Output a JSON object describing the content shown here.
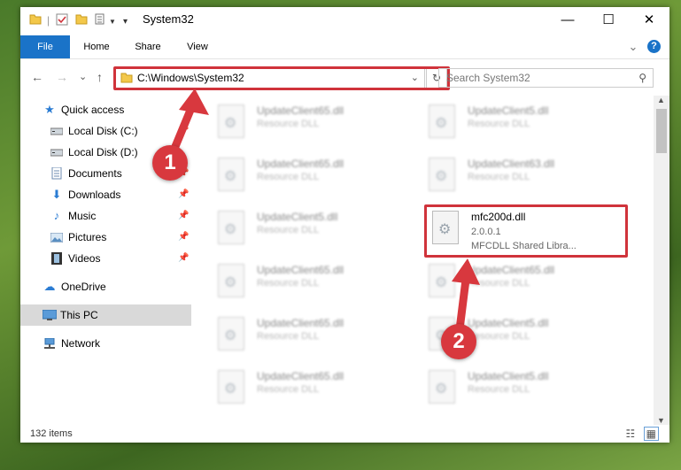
{
  "window": {
    "title": "System32",
    "controls": {
      "minimize": "—",
      "maximize": "☐",
      "close": "✕"
    }
  },
  "ribbon": {
    "tabs": [
      "File",
      "Home",
      "Share",
      "View"
    ],
    "expand": "⌄",
    "help": "?"
  },
  "nav": {
    "back": "←",
    "forward": "→",
    "recent": "⌄",
    "up": "↑",
    "address": "C:\\Windows\\System32",
    "address_dropdown": "⌄",
    "refresh": "↻",
    "search_placeholder": "Search System32"
  },
  "sidebar": {
    "items": [
      {
        "label": "Quick access",
        "icon": "star-icon"
      },
      {
        "label": "Local Disk (C:)",
        "icon": "drive-icon"
      },
      {
        "label": "Local Disk (D:)",
        "icon": "drive-icon"
      },
      {
        "label": "Documents",
        "icon": "documents-icon"
      },
      {
        "label": "Downloads",
        "icon": "downloads-icon"
      },
      {
        "label": "Music",
        "icon": "music-icon"
      },
      {
        "label": "Pictures",
        "icon": "pictures-icon"
      },
      {
        "label": "Videos",
        "icon": "videos-icon"
      },
      {
        "label": "OneDrive",
        "icon": "cloud-icon"
      },
      {
        "label": "This PC",
        "icon": "computer-icon"
      },
      {
        "label": "Network",
        "icon": "network-icon"
      }
    ]
  },
  "files": {
    "left": [
      {
        "name": "UpdateClient65.dll",
        "type": "Resource DLL"
      },
      {
        "name": "UpdateClient65.dll",
        "type": "Resource DLL"
      },
      {
        "name": "UpdateClient5.dll",
        "type": "Resource DLL"
      },
      {
        "name": "UpdateClient65.dll",
        "type": "Resource DLL"
      },
      {
        "name": "UpdateClient65.dll",
        "type": "Resource DLL"
      },
      {
        "name": "UpdateClient65.dll",
        "type": "Resource DLL"
      }
    ],
    "right": [
      {
        "name": "UpdateClient5.dll",
        "type": "Resource DLL"
      },
      {
        "name": "UpdateClient63.dll",
        "type": "Resource DLL"
      },
      {
        "name": "UpdateClient65.dll",
        "type": "Resource DLL"
      },
      {
        "name": "UpdateClient5.dll",
        "type": "Resource DLL"
      },
      {
        "name": "UpdateClient5.dll",
        "type": "Resource DLL"
      }
    ],
    "highlighted": {
      "name": "mfc200d.dll",
      "version": "2.0.0.1",
      "description": "MFCDLL Shared Libra..."
    }
  },
  "status": {
    "item_count": "132 items"
  },
  "annotations": {
    "badge1": "1",
    "badge2": "2",
    "color": "#d8383e"
  }
}
